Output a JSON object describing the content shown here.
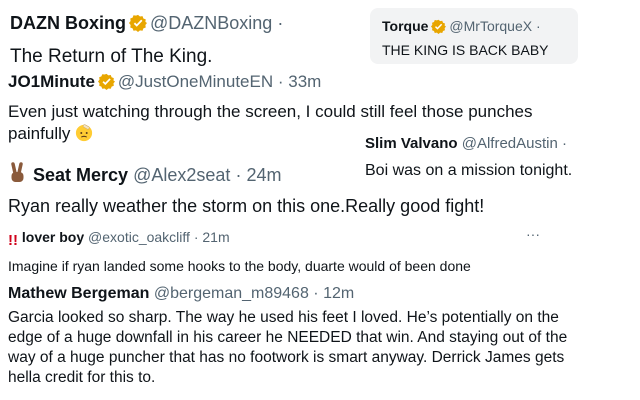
{
  "tweets": [
    {
      "name": "DAZN Boxing",
      "handle": "@DAZNBoxing",
      "sep": "·",
      "time": "",
      "text": "The Return of The King.",
      "verified_color": "#e8a600"
    },
    {
      "name": "Torque",
      "handle": "@MrTorqueX",
      "sep": "·",
      "time": "",
      "text": "THE KING IS BACK BABY",
      "verified_color": "#e8a600"
    },
    {
      "name": "JO1Minute",
      "handle": "@JustOneMinuteEN",
      "sep": "·",
      "time": "33m",
      "text": "Even just watching through the screen, I could still feel those punches painfully",
      "verified_color": "#e8a600"
    },
    {
      "name": "Slim Valvano",
      "handle": "@AlfredAustin",
      "sep": "·",
      "time": "",
      "text": "Boi was on a mission tonight."
    },
    {
      "name": "Seat Mercy",
      "handle": "@Alex2seat",
      "sep": "·",
      "time": "24m",
      "text": "Ryan really weather the storm on this one.Really good fight!"
    },
    {
      "name": "lover boy",
      "handle": "@exotic_oakcliff",
      "sep": "·",
      "time": "21m",
      "text": "Imagine if ryan landed some hooks to the body, duarte would of been done",
      "more": "···"
    },
    {
      "name": "Mathew Bergeman",
      "handle": "@bergeman_m89468",
      "sep": "·",
      "time": "12m",
      "text": "Garcia looked so sharp. The way he used his feet I loved. He’s potentially on the edge of a huge downfall in his career he NEEDED that win. And staying out of the way of a huge puncher that has no footwork is smart anyway. Derrick James gets hella credit for this to."
    }
  ]
}
